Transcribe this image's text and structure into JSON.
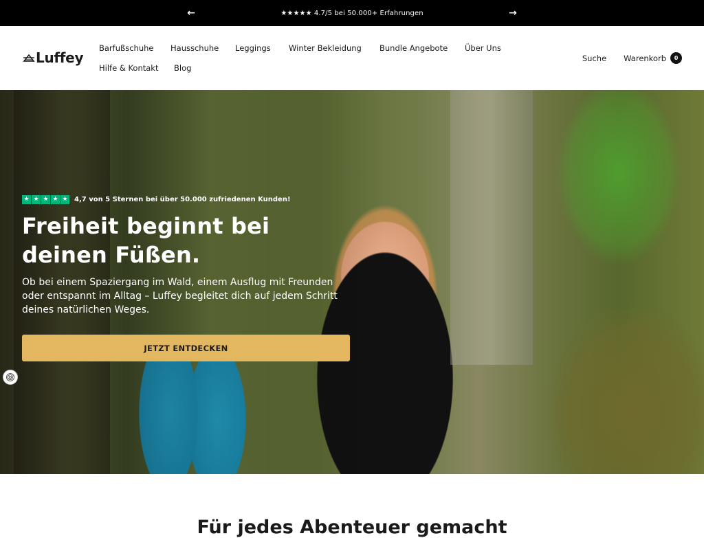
{
  "announcement": {
    "prev_icon": "arrow-left-icon",
    "next_icon": "arrow-right-icon",
    "message": "★★★★★ 4.7/5 bei 50.000+ Erfahrungen"
  },
  "header": {
    "logo_text": "Luffey",
    "nav": [
      {
        "label": "Barfußschuhe"
      },
      {
        "label": "Hausschuhe"
      },
      {
        "label": "Leggings"
      },
      {
        "label": "Winter Bekleidung"
      },
      {
        "label": "Bundle Angebote"
      },
      {
        "label": "Über Uns"
      },
      {
        "label": "Hilfe & Kontakt"
      },
      {
        "label": "Blog"
      }
    ],
    "search_label": "Suche",
    "cart_label": "Warenkorb",
    "cart_count": "0"
  },
  "hero": {
    "rating_text": "4,7 von 5 Sternen bei über 50.000 zufriedenen Kunden!",
    "stars": "★",
    "title": "Freiheit beginnt bei deinen Füßen.",
    "description": "Ob bei einem Spaziergang im Wald, einem Ausflug mit Freunden oder entspannt im Alltag – Luffey begleitet dich auf jedem Schritt deines natürlichen Weges.",
    "cta_label": "JETZT ENTDECKEN"
  },
  "section": {
    "title": "Für jedes Abenteuer gemacht"
  },
  "colors": {
    "accent": "#e3b75f",
    "trustpilot": "#00b67a",
    "topbar": "#000000"
  }
}
